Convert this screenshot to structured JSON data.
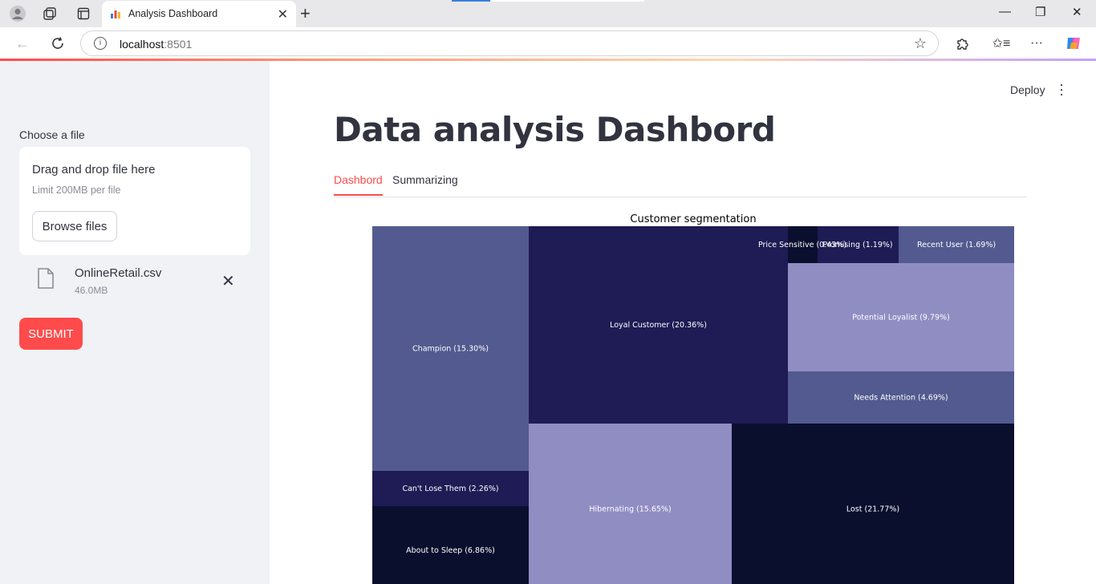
{
  "browser": {
    "tab_title": "Analysis Dashboard",
    "url_host": "localhost",
    "url_port": ":8501"
  },
  "sidebar": {
    "upload_label": "Choose a file",
    "dropzone_title": "Drag and drop file here",
    "dropzone_limit": "Limit 200MB per file",
    "browse_label": "Browse files",
    "file_name": "OnlineRetail.csv",
    "file_size": "46.0MB",
    "submit_label": "SUBMIT"
  },
  "header": {
    "deploy_label": "Deploy"
  },
  "main": {
    "title": "Data analysis Dashbord",
    "tabs": [
      {
        "label": "Dashbord"
      },
      {
        "label": "Summarizing"
      }
    ]
  },
  "colors": {
    "accent": "#ff4b4b",
    "sidebar_bg": "#f0f2f6"
  },
  "chart_data": {
    "type": "treemap",
    "title": "Customer segmentation",
    "segments": [
      {
        "label": "Champion (15.30%)",
        "value": 15.3,
        "color": "#525a8f"
      },
      {
        "label": "Can't Lose Them (2.26%)",
        "value": 2.26,
        "color": "#1e1b55"
      },
      {
        "label": "About to Sleep (6.86%)",
        "value": 6.86,
        "color": "#0b0f2e"
      },
      {
        "label": "Loyal Customer (20.36%)",
        "value": 20.36,
        "color": "#1e1b55"
      },
      {
        "label": "Hibernating (15.65%)",
        "value": 15.65,
        "color": "#908dc2"
      },
      {
        "label": "Lost (21.77%)",
        "value": 21.77,
        "color": "#0b0f2e"
      },
      {
        "label": "Price Sensitive (0.43%)",
        "value": 0.43,
        "color": "#0b0f2e"
      },
      {
        "label": "Promising (1.19%)",
        "value": 1.19,
        "color": "#1e1b55"
      },
      {
        "label": "Recent User (1.69%)",
        "value": 1.69,
        "color": "#525a8f"
      },
      {
        "label": "Potential Loyalist (9.79%)",
        "value": 9.79,
        "color": "#908dc2"
      },
      {
        "label": "Needs Attention (4.69%)",
        "value": 4.69,
        "color": "#525a8f"
      }
    ]
  }
}
